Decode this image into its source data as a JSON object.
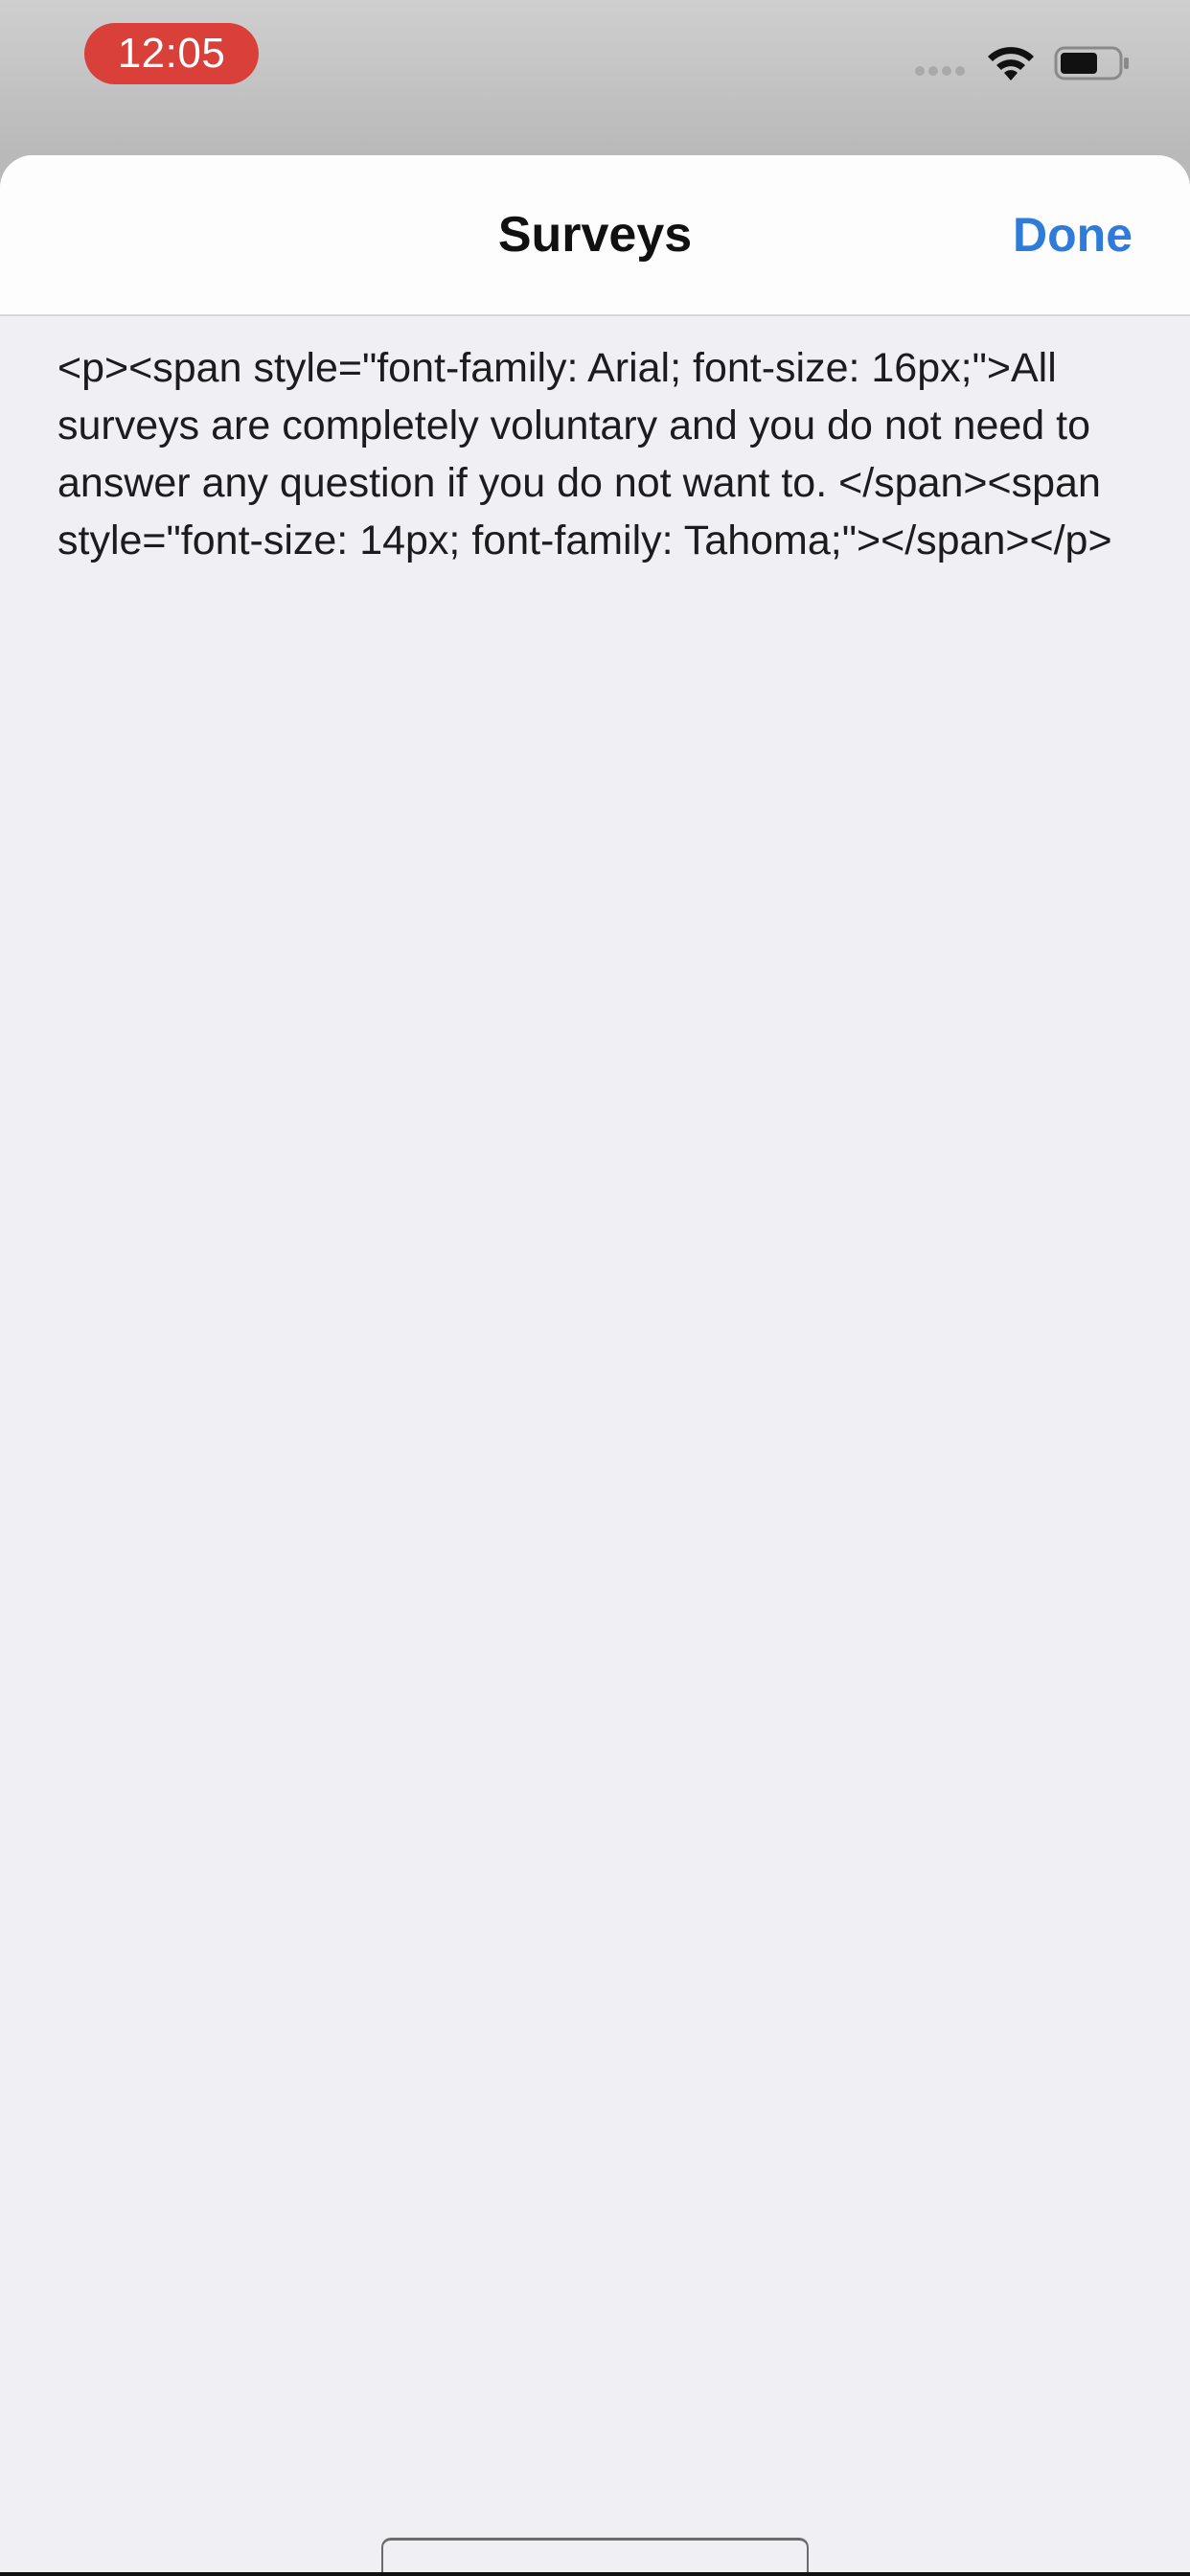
{
  "status_bar": {
    "time": "12:05",
    "wifi_icon": "wifi-icon",
    "battery_icon": "battery-icon",
    "time_pill_color": "#d9403a"
  },
  "nav": {
    "title": "Surveys",
    "done_label": "Done",
    "accent_color": "#2f7bd9"
  },
  "content": {
    "body": "<p><span style=\"font-family: Arial; font-size: 16px;\">All surveys are completely voluntary and you do not need to answer any question if you do not want to. </span><span style=\"font-size: 14px; font-family: Tahoma;\"></span></p>"
  }
}
